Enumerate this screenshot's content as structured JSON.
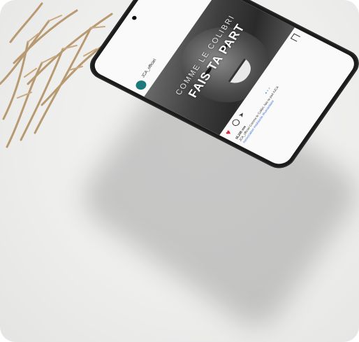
{
  "post": {
    "username": "JCA_officiel",
    "subline": "",
    "overlay_small": "COMME LE COLIBRI",
    "overlay_big": "FAIS TA PART",
    "likes": "16,236 vue",
    "caption": "JCA_officiel Comme le Colibri, fais ta part #JCA",
    "hashtags": "#association #solidarite #humanitaire",
    "time": ""
  },
  "colors": {
    "accent_teal": "#1d7a7c",
    "heart_red": "#e0263a",
    "link_blue": "#3b6fd6"
  }
}
